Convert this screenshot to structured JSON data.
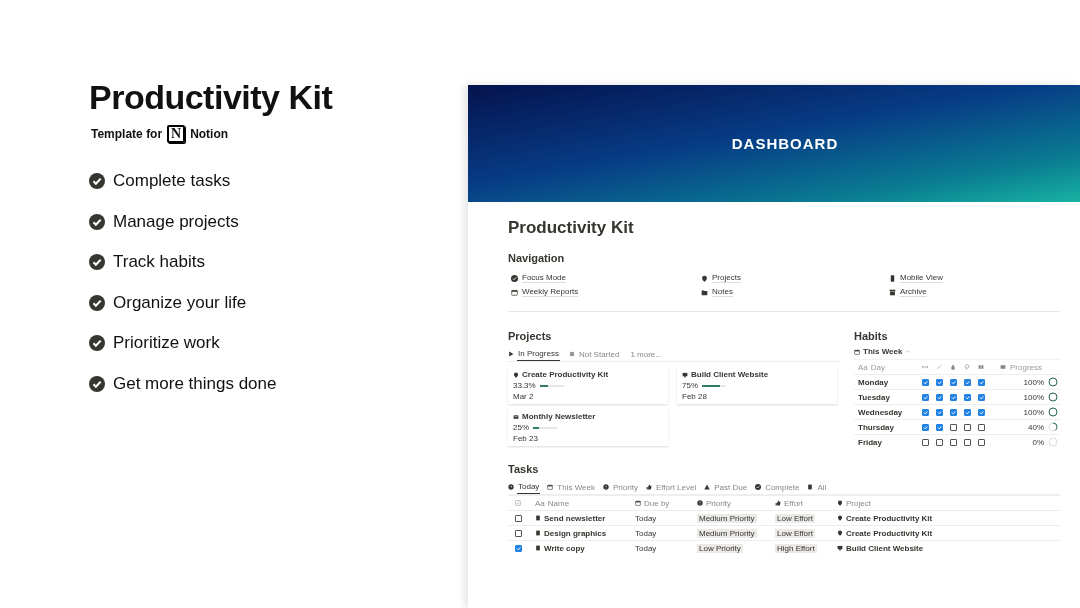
{
  "promo": {
    "title": "Productivity Kit",
    "subtitle": "Template for",
    "logo_letter": "N",
    "brand": "Notion",
    "features": [
      "Complete tasks",
      "Manage projects",
      "Track habits",
      "Organize your life",
      "Prioritize work",
      "Get more things done"
    ]
  },
  "page": {
    "banner_title": "DASHBOARD",
    "title": "Productivity Kit",
    "navigation": {
      "heading": "Navigation",
      "links": [
        "Focus Mode",
        "Projects",
        "Mobile View",
        "Weekly Reports",
        "Notes",
        "Archive"
      ]
    },
    "projects": {
      "heading": "Projects",
      "tabs": [
        {
          "label": "In Progress",
          "selected": true
        },
        {
          "label": "Not Started",
          "selected": false
        },
        {
          "label": "1 more...",
          "selected": false
        }
      ],
      "cards": [
        {
          "name": "Create Productivity Kit",
          "percent": "33.3%",
          "level": 0.333,
          "date": "Mar 2"
        },
        {
          "name": "Build Client Website",
          "percent": "75%",
          "level": 0.75,
          "date": "Feb 28"
        },
        {
          "name": "Monthly Newsletter",
          "percent": "25%",
          "level": 0.25,
          "date": "Feb 23"
        }
      ]
    },
    "habits": {
      "heading": "Habits",
      "view": "This Week",
      "day_icon": "Aa",
      "day_column": "Day",
      "progress_column": "Progress",
      "rows": [
        {
          "day": "Monday",
          "checks": [
            true,
            true,
            true,
            true,
            true
          ],
          "percent": "100%",
          "level": 1
        },
        {
          "day": "Tuesday",
          "checks": [
            true,
            true,
            true,
            true,
            true
          ],
          "percent": "100%",
          "level": 1
        },
        {
          "day": "Wednesday",
          "checks": [
            true,
            true,
            true,
            true,
            true
          ],
          "percent": "100%",
          "level": 1
        },
        {
          "day": "Thursday",
          "checks": [
            true,
            true,
            false,
            false,
            false
          ],
          "percent": "40%",
          "level": 0.4
        },
        {
          "day": "Friday",
          "checks": [
            false,
            false,
            false,
            false,
            false
          ],
          "percent": "0%",
          "level": 0
        }
      ]
    },
    "tasks": {
      "heading": "Tasks",
      "tabs": [
        {
          "label": "Today",
          "selected": true
        },
        {
          "label": "This Week",
          "selected": false
        },
        {
          "label": "Priority",
          "selected": false
        },
        {
          "label": "Effort Level",
          "selected": false
        },
        {
          "label": "Past Due",
          "selected": false
        },
        {
          "label": "Complete",
          "selected": false
        },
        {
          "label": "All",
          "selected": false
        }
      ],
      "name_icon": "Aa",
      "columns": [
        "Name",
        "Due by",
        "Priority",
        "Effort",
        "Project"
      ],
      "rows": [
        {
          "done": false,
          "name": "Send newsletter",
          "due": "Today",
          "priority": "Medium Priority",
          "effort": "Low Effort",
          "project": "Create Productivity Kit"
        },
        {
          "done": false,
          "name": "Design graphics",
          "due": "Today",
          "priority": "Medium Priority",
          "effort": "Low Effort",
          "project": "Create Productivity Kit"
        },
        {
          "done": true,
          "name": "Write copy",
          "due": "Today",
          "priority": "Low Priority",
          "effort": "High Effort",
          "project": "Build Client Website"
        }
      ]
    }
  }
}
